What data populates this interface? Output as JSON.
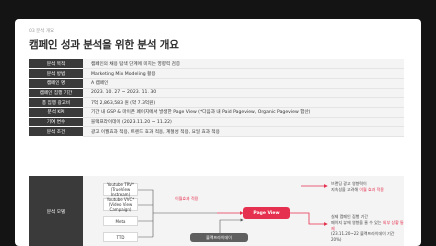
{
  "breadcrumb": "03 분석 개요",
  "title": "캠페인 성과 분석을 위한 분석 개요",
  "rows": [
    {
      "k": "분석 목적",
      "v": "캠페인의 채용 탐색 단계에 미치는 영향력 검증"
    },
    {
      "k": "분석 방법",
      "v": "Marketing Mix Modeling 활용"
    },
    {
      "k": "캠페인 명",
      "v": "A 캠페인"
    },
    {
      "k": "캠페인 집행 기간",
      "v": "2023. 10. 27 ~ 2023. 11. 30"
    },
    {
      "k": "총 집행 광고비",
      "v": "7억 2,863,583 원 (약 7.3억원)"
    },
    {
      "k": "분석 KPI",
      "v": "기간 내 GSP & 마이픈 페이지에서 발생한 Page View (*다음과 내 Paid Pageview, Organic Pageview 합산)"
    },
    {
      "k": "기여 변수",
      "v": "블랙프라이데이 (2023.11.20 ~ 11.22)"
    },
    {
      "k": "분석 조건",
      "v": "광고 이월효과 적용, 트렌드 효과 적용, 계절성 적용, 요일 효과 적용"
    }
  ],
  "model": {
    "label": "분석 모델",
    "inputs": [
      {
        "l1": "Youtube TRV*",
        "l2": "(TrueView Instream)"
      },
      {
        "l1": "Youtube VVC*",
        "l2": "(Video View Campaign)"
      },
      {
        "l1": "Meta",
        "l2": ""
      },
      {
        "l1": "TTD",
        "l2": ""
      }
    ],
    "carryover": "이월효과 적용",
    "output": "Page View",
    "event": "블랙프라이데이",
    "note1": {
      "line1": "브랜딩 광고 영향력이",
      "line2a": "지속성을 고려해 ",
      "line2b": "이월 효과 적용"
    },
    "note2": {
      "line1": "실제 캠페인 집행 기간",
      "line2a": "페이지 뷰에 영향을 줄 수 있는 ",
      "line2b": "외부 상황 통제",
      "line3": "(23.11.20~22 블랙프라이데이 기간 20%)"
    }
  },
  "colors": {
    "accent": "#e6304f",
    "header_cell": "#3a3a3a",
    "event_box": "#5f5f5f"
  }
}
